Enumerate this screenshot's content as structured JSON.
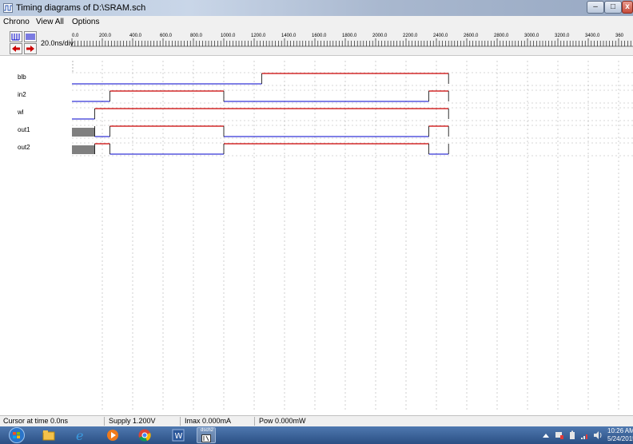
{
  "window": {
    "title": "Timing diagrams of D:\\SRAM.sch"
  },
  "menu": [
    "Chrono",
    "View All",
    "Options"
  ],
  "toolbar": {
    "scale": "20.0ns/div"
  },
  "ruler_ticks": [
    "0.0",
    "200.0",
    "400.0",
    "600.0",
    "800.0",
    "1000.0",
    "1200.0",
    "1400.0",
    "1600.0",
    "1800.0",
    "2000.0",
    "2200.0",
    "2400.0",
    "2600.0",
    "2800.0",
    "3000.0",
    "3200.0",
    "3400.0",
    "360"
  ],
  "signals": [
    {
      "name": "blb",
      "init": "0",
      "transitions": [
        [
          1250,
          "1"
        ],
        [
          2480,
          "end"
        ]
      ]
    },
    {
      "name": "in2",
      "init": "0",
      "transitions": [
        [
          250,
          "1"
        ],
        [
          1000,
          "0"
        ],
        [
          2350,
          "1"
        ],
        [
          2480,
          "end"
        ]
      ]
    },
    {
      "name": "wl",
      "init": "0",
      "transitions": [
        [
          150,
          "1"
        ],
        [
          2480,
          "end"
        ]
      ]
    },
    {
      "name": "out1",
      "init": "X",
      "transitions": [
        [
          150,
          "0"
        ],
        [
          250,
          "1"
        ],
        [
          1000,
          "0"
        ],
        [
          2350,
          "1"
        ],
        [
          2480,
          "end"
        ]
      ]
    },
    {
      "name": "out2",
      "init": "X",
      "transitions": [
        [
          150,
          "1"
        ],
        [
          250,
          "0"
        ],
        [
          1000,
          "1"
        ],
        [
          2350,
          "0"
        ],
        [
          2480,
          "end"
        ]
      ]
    }
  ],
  "colors": {
    "high": "#cc0000",
    "low": "#0000cc",
    "unknown": "#808080",
    "grid": "#b0b0b0"
  },
  "status": {
    "cursor": "Cursor at time 0.0ns",
    "supply": "Supply 1.200V",
    "imax": "Imax 0.000mA",
    "pow": "Pow 0.000mW"
  },
  "taskbar": {
    "task_label": "dsch2",
    "time": "10:26 AM",
    "date": "5/24/2015",
    "icons": [
      "start-orb-icon",
      "file-explorer-icon",
      "internet-explorer-icon",
      "media-player-icon",
      "chrome-icon",
      "word-icon",
      "dsch2-icon"
    ]
  }
}
